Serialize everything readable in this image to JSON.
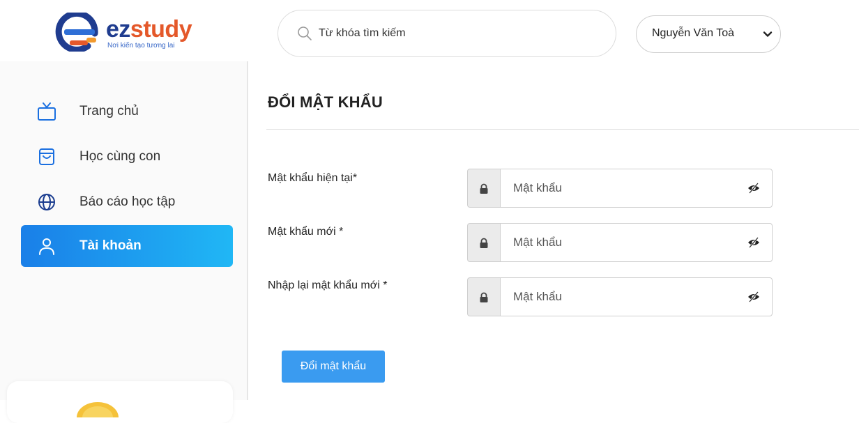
{
  "brand": {
    "name_part1": "ez",
    "name_part2": "study",
    "slogan": "Nơi kiến tạo tương lai",
    "colors": {
      "navy": "#1f3c8f",
      "orange": "#e4582a",
      "blue": "#3767c7"
    }
  },
  "search": {
    "placeholder": "Từ khóa tìm kiếm",
    "icon": "search-icon"
  },
  "user_menu": {
    "selected": "Nguyễn Văn Toà",
    "icon": "chevron-down-icon"
  },
  "sidebar": {
    "items": [
      {
        "label": "Trang chủ",
        "icon": "tv-icon",
        "active": false
      },
      {
        "label": "Học cùng con",
        "icon": "shopping-bag-icon",
        "active": false
      },
      {
        "label": "Báo cáo học tập",
        "icon": "globe-icon",
        "active": false
      },
      {
        "label": "Tài khoản",
        "icon": "user-icon",
        "active": true
      }
    ],
    "accent": "#1a7fe8"
  },
  "main": {
    "title": "ĐỔI MẬT KHẨU",
    "fields": [
      {
        "label": "Mật khẩu hiện tại*",
        "placeholder": "Mật khẩu"
      },
      {
        "label": "Mật khẩu mới *",
        "placeholder": "Mật khẩu"
      },
      {
        "label": "Nhập lại mật khẩu mới *",
        "placeholder": "Mật khẩu"
      }
    ],
    "submit_label": "Đổi mật khẩu",
    "submit_color": "#3a9bf0"
  }
}
